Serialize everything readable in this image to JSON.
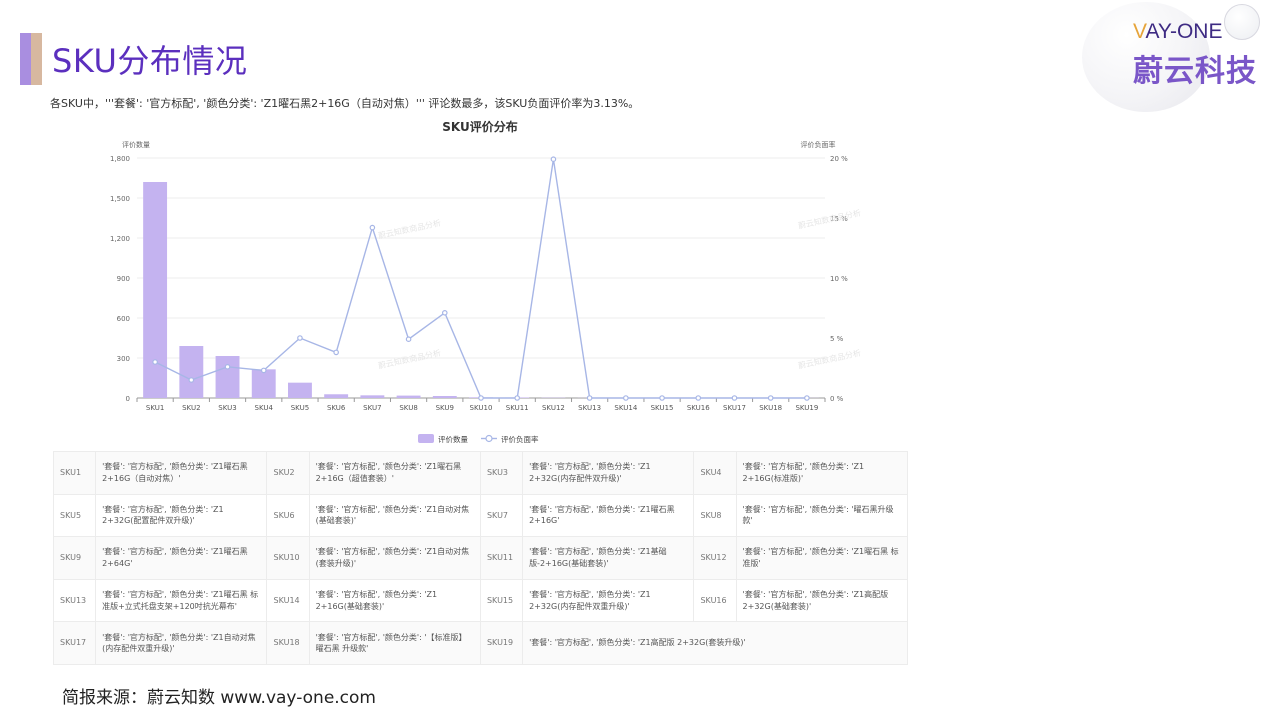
{
  "header": {
    "title": "SKU分布情况",
    "logo_en_v": "V",
    "logo_en_rest": "AY-ONE",
    "logo_cn": "蔚云科技"
  },
  "summary": "各SKU中，'''套餐': '官方标配', '颜色分类': 'Z1曜石黑2+16G（自动对焦）''' 评论数最多，该SKU负面评价率为3.13%。",
  "chart_data": {
    "type": "bar",
    "title": "SKU评价分布",
    "categories": [
      "SKU1",
      "SKU2",
      "SKU3",
      "SKU4",
      "SKU5",
      "SKU6",
      "SKU7",
      "SKU8",
      "SKU9",
      "SKU10",
      "SKU11",
      "SKU12",
      "SKU13",
      "SKU14",
      "SKU15",
      "SKU16",
      "SKU17",
      "SKU18",
      "SKU19"
    ],
    "series": [
      {
        "name": "评价数量",
        "type": "bar",
        "axis": "left",
        "color": "#c4b3f0",
        "values": [
          1620,
          390,
          315,
          215,
          115,
          28,
          20,
          18,
          15,
          5,
          4,
          2,
          1,
          1,
          1,
          1,
          1,
          1,
          1
        ]
      },
      {
        "name": "评价负面率",
        "type": "line",
        "axis": "right",
        "color": "#a7b6e6",
        "values": [
          3.0,
          1.5,
          2.6,
          2.3,
          5.0,
          3.8,
          14.2,
          4.9,
          7.1,
          0,
          0,
          19.9,
          0,
          0,
          0,
          0,
          0,
          0,
          0
        ]
      }
    ],
    "ylabel_left": "评价数量",
    "ylabel_right": "评价负面率",
    "ylim_left": [
      0,
      1800
    ],
    "yticks_left": [
      "0",
      "300",
      "600",
      "900",
      "1,200",
      "1,500",
      "1,800"
    ],
    "ylim_right": [
      0,
      20
    ],
    "yticks_right": [
      "0 %",
      "5 %",
      "10 %",
      "15 %",
      "20 %"
    ],
    "grid": true,
    "legend": "bottom-center",
    "watermark": "蔚云知数商品分析"
  },
  "table": [
    [
      {
        "sku": "SKU1",
        "desc": "'套餐': '官方标配', '颜色分类': 'Z1曜石黑2+16G（自动对焦）'"
      },
      {
        "sku": "SKU2",
        "desc": "'套餐': '官方标配', '颜色分类': 'Z1曜石黑2+16G（超值套装）'"
      },
      {
        "sku": "SKU3",
        "desc": "'套餐': '官方标配', '颜色分类': 'Z1 2+32G(内存配件双升级)'"
      },
      {
        "sku": "SKU4",
        "desc": "'套餐': '官方标配', '颜色分类': 'Z1 2+16G(标准版)'"
      }
    ],
    [
      {
        "sku": "SKU5",
        "desc": "'套餐': '官方标配', '颜色分类': 'Z1 2+32G(配置配件双升级)'"
      },
      {
        "sku": "SKU6",
        "desc": "'套餐': '官方标配', '颜色分类': 'Z1自动对焦(基础套装)'"
      },
      {
        "sku": "SKU7",
        "desc": "'套餐': '官方标配', '颜色分类': 'Z1曜石黑2+16G'"
      },
      {
        "sku": "SKU8",
        "desc": "'套餐': '官方标配', '颜色分类': '曜石黑升级款'"
      }
    ],
    [
      {
        "sku": "SKU9",
        "desc": "'套餐': '官方标配', '颜色分类': 'Z1曜石黑 2+64G'"
      },
      {
        "sku": "SKU10",
        "desc": "'套餐': '官方标配', '颜色分类': 'Z1自动对焦(套装升级)'"
      },
      {
        "sku": "SKU11",
        "desc": "'套餐': '官方标配', '颜色分类': 'Z1基础版-2+16G(基础套装)'"
      },
      {
        "sku": "SKU12",
        "desc": "'套餐': '官方标配', '颜色分类': 'Z1曜石黑 标准版'"
      }
    ],
    [
      {
        "sku": "SKU13",
        "desc": "'套餐': '官方标配', '颜色分类': 'Z1曜石黑 标准版+立式托盘支架+120吋抗光幕布'"
      },
      {
        "sku": "SKU14",
        "desc": "'套餐': '官方标配', '颜色分类': 'Z1 2+16G(基础套装)'"
      },
      {
        "sku": "SKU15",
        "desc": "'套餐': '官方标配', '颜色分类': 'Z1 2+32G(内存配件双重升级)'"
      },
      {
        "sku": "SKU16",
        "desc": "'套餐': '官方标配', '颜色分类': 'Z1高配版 2+32G(基础套装)'"
      }
    ],
    [
      {
        "sku": "SKU17",
        "desc": "'套餐': '官方标配', '颜色分类': 'Z1自动对焦(内存配件双重升级)'"
      },
      {
        "sku": "SKU18",
        "desc": "'套餐': '官方标配', '颜色分类': '【标准版】曜石黑 升级款'"
      },
      {
        "sku": "SKU19",
        "desc": "'套餐': '官方标配', '颜色分类': 'Z1高配版 2+32G(套装升级)'"
      }
    ]
  ],
  "footer": {
    "source": "简报来源：蔚云知数 www.vay-one.com"
  }
}
